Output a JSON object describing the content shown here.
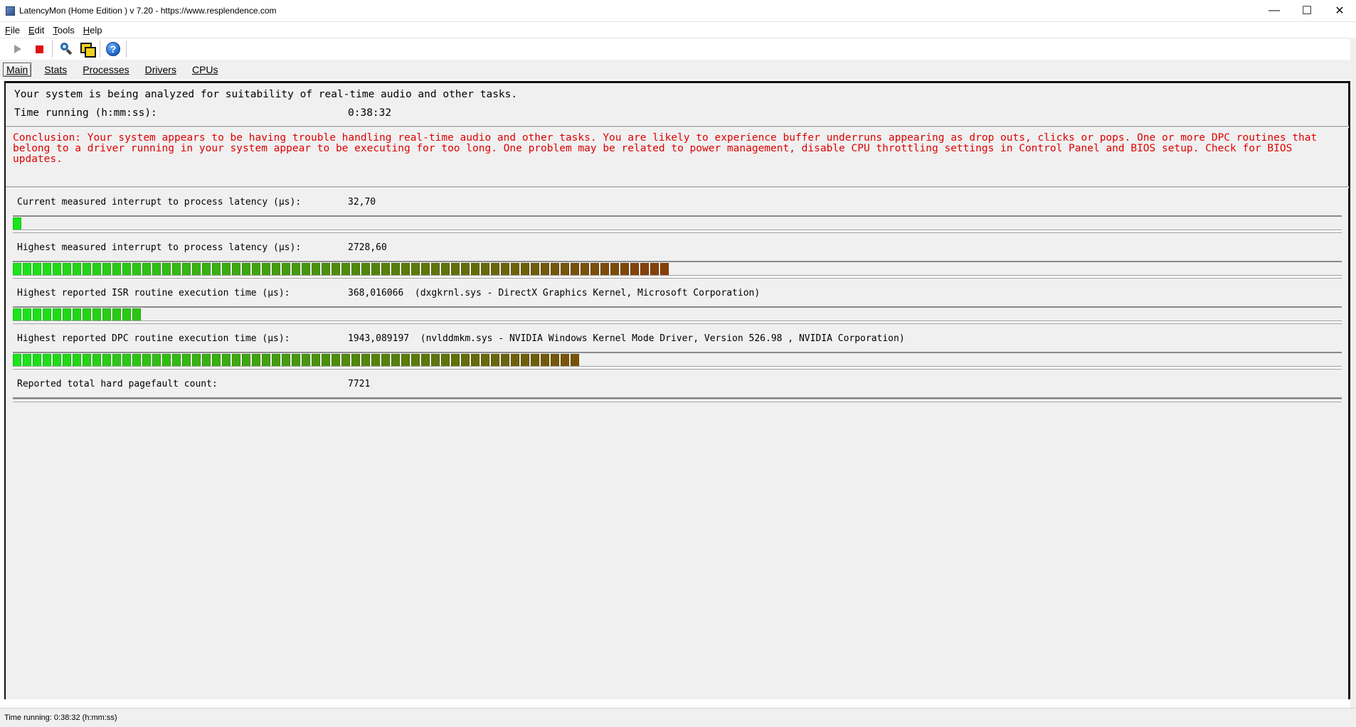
{
  "window": {
    "title": "LatencyMon  (Home Edition )  v 7.20 - https://www.resplendence.com",
    "minimize_glyph": "—",
    "maximize_glyph": "☐",
    "close_glyph": "✕"
  },
  "menu": [
    {
      "key": "F",
      "rest": "ile"
    },
    {
      "key": "E",
      "rest": "dit"
    },
    {
      "key": "T",
      "rest": "ools"
    },
    {
      "key": "H",
      "rest": "elp"
    }
  ],
  "toolbar": {
    "icons": [
      "play-icon",
      "stop-icon",
      "search-icon",
      "windows-icon",
      "help-icon"
    ],
    "help_glyph": "?"
  },
  "tabs": [
    "Main",
    "Stats",
    "Processes",
    "Drivers",
    "CPUs"
  ],
  "active_tab": "Main",
  "main": {
    "analysis_line": "Your system is being analyzed for suitability of real-time audio and other tasks.",
    "time_label": "Time running (h:mm:ss):",
    "time_value": "0:38:32",
    "conclusion": "Conclusion: Your system appears to be having trouble handling real-time audio and other tasks. You are likely to experience buffer underruns appearing as drop outs, clicks or pops. One or more DPC routines that belong to a driver running in your system appear to be executing for too long. One problem may be related to power management, disable CPU throttling settings in Control Panel and BIOS setup. Check for BIOS updates.",
    "metrics": [
      {
        "label": "Current measured interrupt to process latency (µs):",
        "value": "32,70",
        "bar_fraction": 0.006
      },
      {
        "label": "Highest measured interrupt to process latency (µs):",
        "value": "2728,60",
        "bar_fraction": 0.496
      },
      {
        "label": "Highest reported ISR routine execution time (µs):",
        "value": "368,016066  (dxgkrnl.sys - DirectX Graphics Kernel, Microsoft Corporation)",
        "bar_fraction": 0.101
      },
      {
        "label": "Highest reported DPC routine execution time (µs):",
        "value": "1943,089197  (nvlddmkm.sys - NVIDIA Windows Kernel Mode Driver, Version 526.98 , NVIDIA Corporation)",
        "bar_fraction": 0.427
      },
      {
        "label": "Reported total hard pagefault count:",
        "value": "7721",
        "bar_fraction": null
      }
    ]
  },
  "colors": {
    "bar_low": "#19e619",
    "bar_mid": "#4f8a0c",
    "bar_high": "#8a3a08",
    "conclusion_text": "#e00000"
  },
  "statusbar": {
    "text": "Time running: 0:38:32  (h:mm:ss)"
  }
}
